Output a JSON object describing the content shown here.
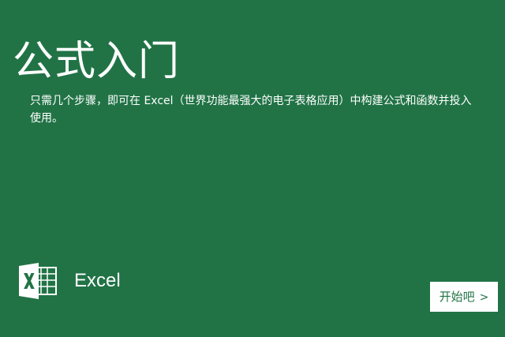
{
  "slide": {
    "title": "公式入门",
    "description": "只需几个步骤，即可在 Excel（世界功能最强大的电子表格应用）中构建公式和函数并投入使用。"
  },
  "logo": {
    "icon": "excel-icon",
    "label": "Excel"
  },
  "start_button": {
    "label": "开始吧",
    "arrow": ">"
  },
  "colors": {
    "background": "#217346",
    "text": "#ffffff",
    "button_background": "#ffffff",
    "button_text": "#217346"
  }
}
